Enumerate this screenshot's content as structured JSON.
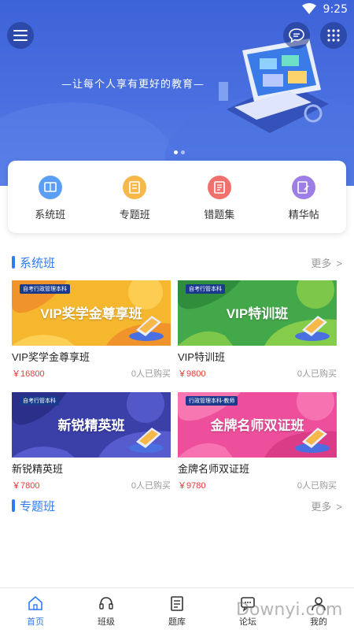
{
  "status_bar": {
    "time": "9:25"
  },
  "banner": {
    "slogan": "—让每个人享有更好的教育—"
  },
  "quick_nav": [
    {
      "label": "系统班",
      "color": "#5b9ef5"
    },
    {
      "label": "专题班",
      "color": "#f7b84a"
    },
    {
      "label": "错题集",
      "color": "#f0706b"
    },
    {
      "label": "精华帖",
      "color": "#9d7ee6"
    }
  ],
  "sections": {
    "system": {
      "title": "系统班",
      "more": "更多",
      "arrow": ">"
    },
    "topic": {
      "title": "专题班",
      "more": "更多",
      "arrow": ">"
    }
  },
  "courses": [
    {
      "tag": "自考行政管理本科",
      "banner_title": "VIP奖学金尊享班",
      "name": "VIP奖学金尊享班",
      "price": "￥16800",
      "buyers": "0人已购买",
      "bg": "#f5b72e"
    },
    {
      "tag": "自考行管本科",
      "banner_title": "VIP特训班",
      "name": "VIP特训班",
      "price": "￥9800",
      "buyers": "0人已购买",
      "bg": "#43a84a"
    },
    {
      "tag": "自考行管本科",
      "banner_title": "新锐精英班",
      "name": "新锐精英班",
      "price": "￥7800",
      "buyers": "0人已购买",
      "bg": "#3b3fa8"
    },
    {
      "tag": "行政管理本科-教师",
      "banner_title": "金牌名师双证班",
      "name": "金牌名师双证班",
      "price": "￥9780",
      "buyers": "0人已购买",
      "bg": "#ee4f9c"
    }
  ],
  "tabs": [
    {
      "label": "首页",
      "active": true
    },
    {
      "label": "班级",
      "active": false
    },
    {
      "label": "题库",
      "active": false
    },
    {
      "label": "论坛",
      "active": false
    },
    {
      "label": "我的",
      "active": false
    }
  ],
  "watermark": "Downyi.com",
  "colors": {
    "accent": "#2f7cf6",
    "price": "#e53935",
    "banner": "#4a6fe0"
  }
}
